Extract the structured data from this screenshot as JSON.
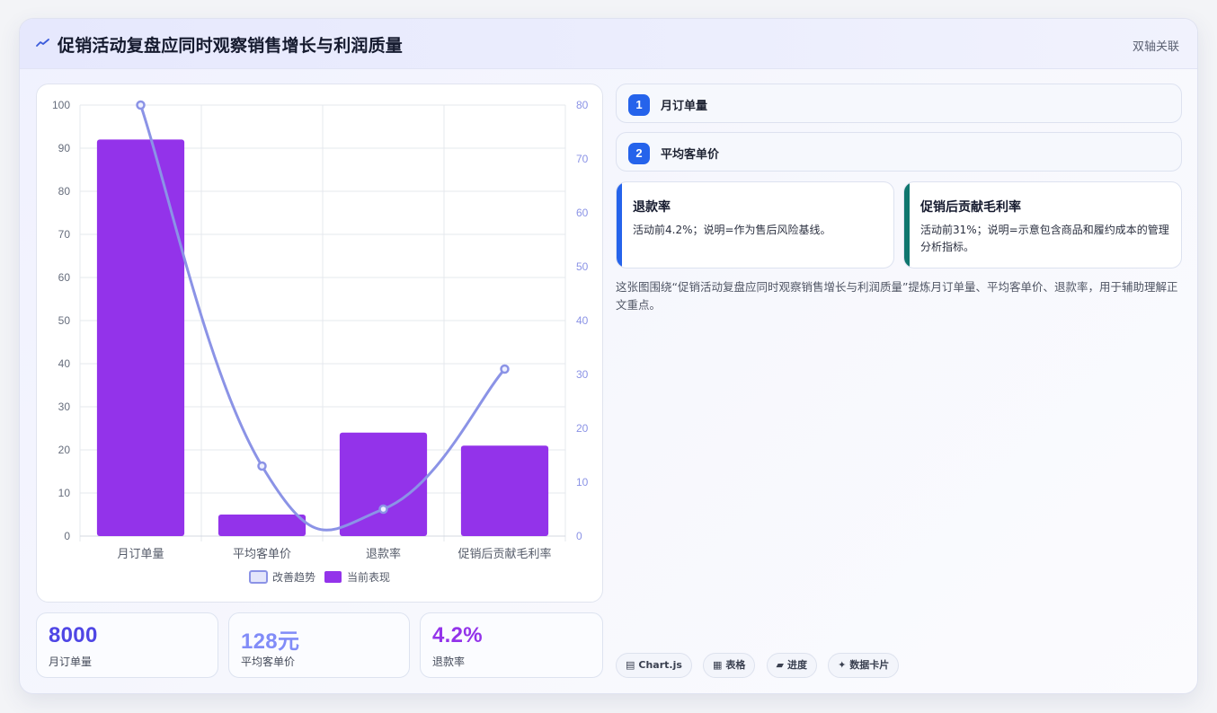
{
  "header": {
    "title": "促销活动复盘应同时观察销售增长与利润质量",
    "tag": "双轴关联",
    "icon": "trend-line-icon"
  },
  "colors": {
    "bar": "#9333ea",
    "line": "#8b93e6",
    "badge": "#2563eb",
    "stat_primary": "#4f46e5",
    "stat_secondary": "#818cf8",
    "stat_tertiary": "#9333ea",
    "card_accent_blue": "#2563eb",
    "card_accent_teal": "#0f766e"
  },
  "chart_data": {
    "type": "bar+line",
    "categories": [
      "月订单量",
      "平均客单价",
      "退款率",
      "促销后贡献毛利率"
    ],
    "series": [
      {
        "name": "当前表现",
        "type": "bar",
        "axis": "left",
        "values": [
          92,
          5,
          24,
          21
        ]
      },
      {
        "name": "改善趋势",
        "type": "line",
        "axis": "right",
        "values": [
          80,
          13,
          5,
          31
        ]
      }
    ],
    "y_left": {
      "min": 0,
      "max": 100,
      "ticks": [
        0,
        10,
        20,
        30,
        40,
        50,
        60,
        70,
        80,
        90,
        100
      ]
    },
    "y_right": {
      "min": 0,
      "max": 80,
      "ticks": [
        0,
        10,
        20,
        30,
        40,
        50,
        60,
        70,
        80
      ]
    },
    "legend": {
      "position": "bottom",
      "items": [
        "改善趋势",
        "当前表现"
      ]
    },
    "grid": true
  },
  "stats": [
    {
      "value": "8000",
      "label": "月订单量"
    },
    {
      "value": "128元",
      "label": "平均客单价"
    },
    {
      "value": "4.2%",
      "label": "退款率"
    }
  ],
  "list": [
    {
      "num": "1",
      "label": "月订单量"
    },
    {
      "num": "2",
      "label": "平均客单价"
    }
  ],
  "cards": [
    {
      "title": "退款率",
      "desc": "活动前4.2%；说明=作为售后风险基线。"
    },
    {
      "title": "促销后贡献毛利率",
      "desc": "活动前31%；说明=示意包含商品和履约成本的管理分析指标。"
    }
  ],
  "summary": "这张图围绕“促销活动复盘应同时观察销售增长与利润质量”提炼月订单量、平均客单价、退款率，用于辅助理解正文重点。",
  "chips": [
    {
      "icon": "chart-icon",
      "glyph": "▤",
      "label": "Chart.js"
    },
    {
      "icon": "table-icon",
      "glyph": "▦",
      "label": "表格"
    },
    {
      "icon": "progress-icon",
      "glyph": "▰",
      "label": "进度"
    },
    {
      "icon": "sparkle-icon",
      "glyph": "✦",
      "label": "数据卡片"
    }
  ]
}
